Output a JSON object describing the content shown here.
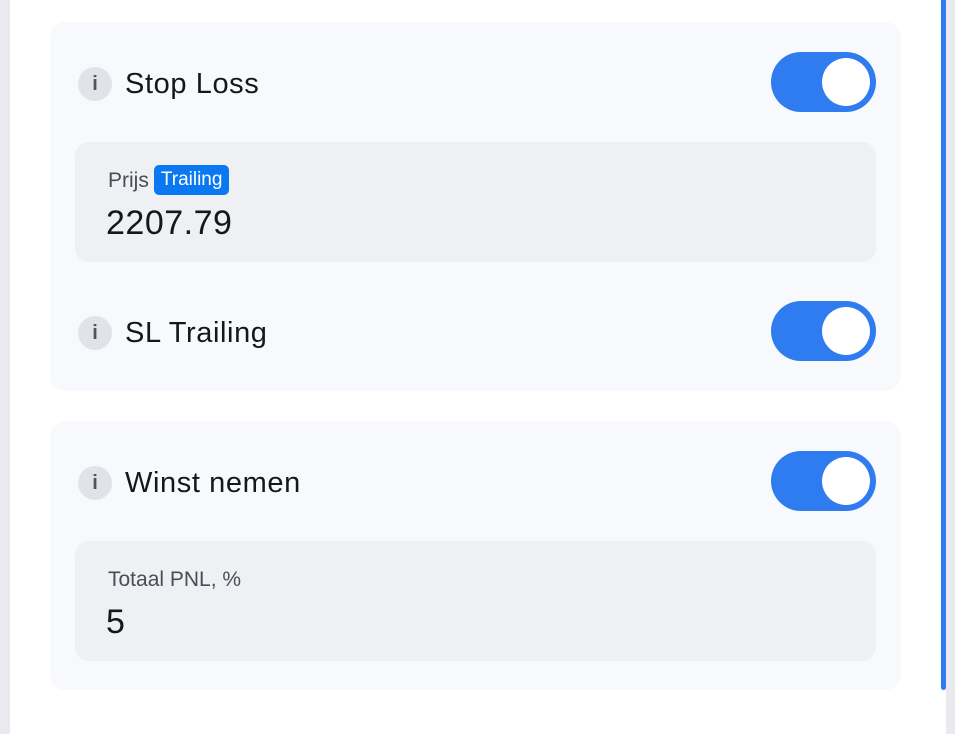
{
  "stop_loss": {
    "label": "Stop Loss",
    "enabled": true,
    "info_glyph": "i",
    "price_field": {
      "label": "Prijs",
      "badge": "Trailing",
      "value": "2207.79"
    },
    "trailing": {
      "label": "SL Trailing",
      "enabled": true,
      "info_glyph": "i"
    }
  },
  "take_profit": {
    "label": "Winst nemen",
    "enabled": true,
    "info_glyph": "i",
    "pnl_field": {
      "label": "Totaal PNL, %",
      "value": "5"
    }
  },
  "colors": {
    "accent": "#2f7bf0",
    "badge": "#0a78f0",
    "card_bg": "#f8f9fc",
    "field_bg": "#eff0f4"
  },
  "icons": {
    "info": "info-icon"
  }
}
